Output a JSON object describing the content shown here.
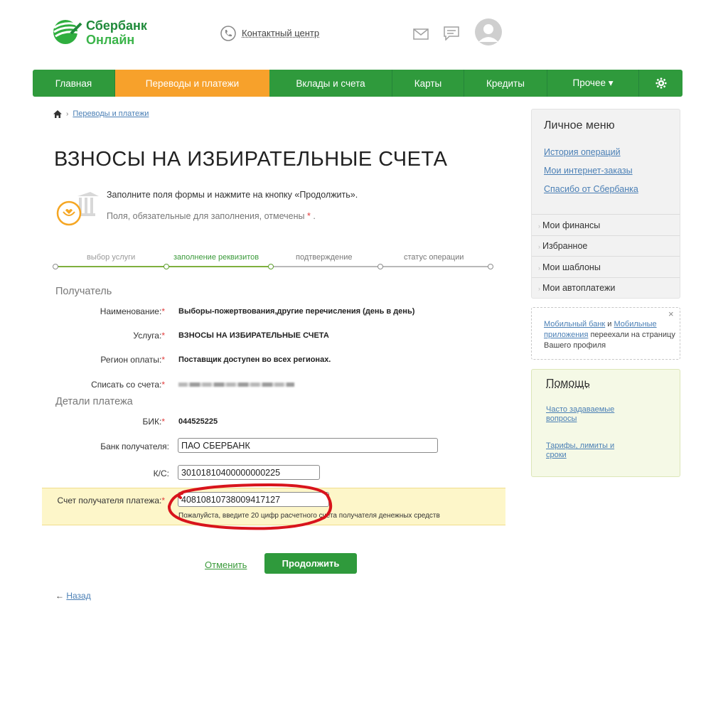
{
  "header": {
    "logo_line1": "Сбербанк",
    "logo_line2": "Онлайн",
    "contact_center": "Контактный центр"
  },
  "nav": {
    "items": [
      {
        "label": "Главная"
      },
      {
        "label": "Переводы и платежи"
      },
      {
        "label": "Вклады и счета"
      },
      {
        "label": "Карты"
      },
      {
        "label": "Кредиты"
      },
      {
        "label": "Прочее ▾"
      }
    ]
  },
  "breadcrumb": {
    "link": "Переводы и платежи"
  },
  "page": {
    "title": "ВЗНОСЫ НА ИЗБИРАТЕЛЬНЫЕ СЧЕТА",
    "hint1": "Заполните поля формы и нажмите на кнопку «Продолжить».",
    "hint2": "Поля, обязательные для заполнения, отмечены",
    "hint2_mark": "*",
    "hint2_end": "."
  },
  "steps": [
    {
      "label": "выбор услуги"
    },
    {
      "label": "заполнение реквизитов"
    },
    {
      "label": "подтверждение"
    },
    {
      "label": "статус операции"
    }
  ],
  "recipient": {
    "section_title": "Получатель",
    "name_label": "Наименование:",
    "name_value": "Выборы-пожертвования,другие перечисления (день в день)",
    "service_label": "Услуга:",
    "service_value": "ВЗНОСЫ НА ИЗБИРАТЕЛЬНЫЕ СЧЕТА",
    "region_label": "Регион оплаты:",
    "region_value": "Поставщик доступен во всех регионах.",
    "account_label": "Списать со счета:",
    "req_mark": "*"
  },
  "details": {
    "section_title": "Детали платежа",
    "bik_label": "БИК:",
    "bik_value": "044525225",
    "bank_label": "Банк получателя:",
    "bank_value": "ПАО СБЕРБАНК",
    "ks_label": "К/С:",
    "ks_value": "30101810400000000225",
    "account_label": "Счет получателя платежа:",
    "account_value": "40810810738009417127",
    "account_hint": "Пожалуйста, введите 20 цифр расчетного счета получателя денежных средств"
  },
  "actions": {
    "cancel": "Отменить",
    "continue": "Продолжить",
    "back_arrow": "←",
    "back": "Назад"
  },
  "sidebar": {
    "title": "Личное меню",
    "links": [
      "История операций",
      "Мои интернет-заказы",
      "Спасибо от Сбербанка"
    ],
    "items": [
      "Мои финансы",
      "Избранное",
      "Мои шаблоны",
      "Мои автоплатежи"
    ]
  },
  "notice": {
    "link1": "Мобильный банк",
    "and": " и ",
    "link2": "Мобильные приложения",
    "rest": " переехали на страницу Вашего профиля",
    "close": "×"
  },
  "help": {
    "title": "Помощь",
    "link1": "Часто задаваемые вопросы",
    "link2": "Тарифы, лимиты и сроки"
  },
  "colors": {
    "brand_green": "#2f9a3c",
    "active_orange": "#f7a12b",
    "annotation_red": "#d8141c",
    "link_blue": "#4a7fb5"
  }
}
